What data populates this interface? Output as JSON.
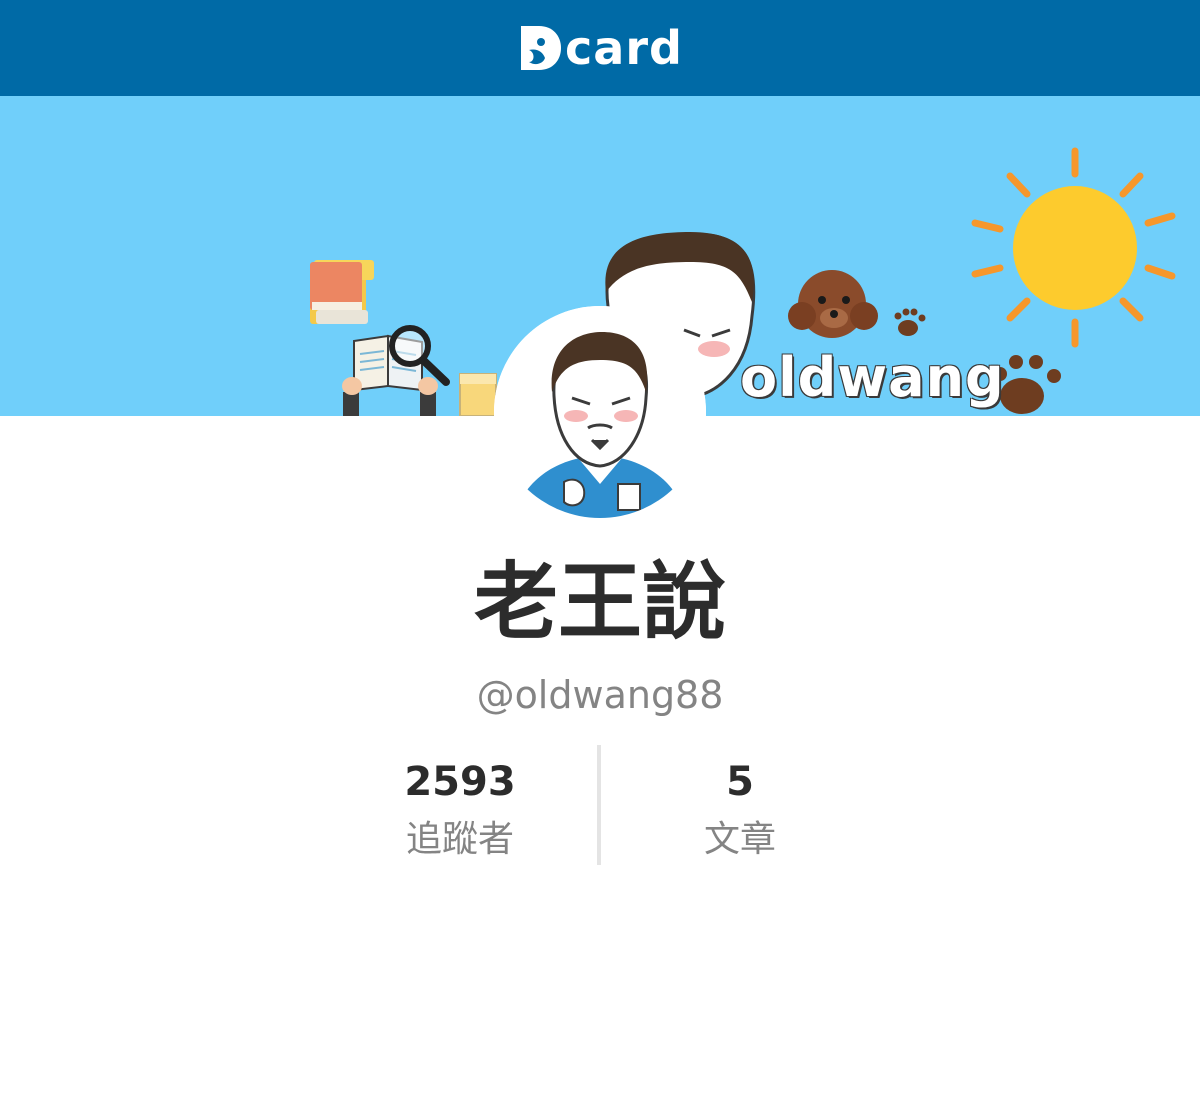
{
  "header": {
    "brand": "card",
    "brand_color": "#006aa6"
  },
  "cover": {
    "banner_text": "oldwang",
    "background_color": "#70cffa"
  },
  "profile": {
    "display_name": "老王說",
    "handle": "@oldwang88"
  },
  "stats": [
    {
      "value": "2593",
      "label": "追蹤者"
    },
    {
      "value": "5",
      "label": "文章"
    }
  ],
  "icons": [
    "dcard-logo-icon",
    "sun-icon",
    "books-icon",
    "magnifier-icon",
    "dog-icon",
    "paw-icon"
  ]
}
